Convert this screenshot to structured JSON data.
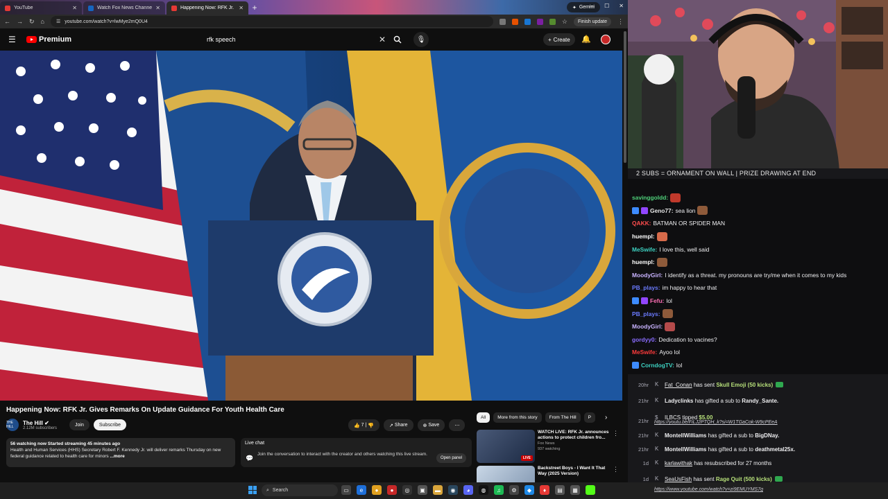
{
  "browser": {
    "tabs": [
      {
        "title": "YouTube",
        "active": false
      },
      {
        "title": "Watch Fox News Channel",
        "active": false
      },
      {
        "title": "Happening Now: RFK Jr. Gi",
        "active": true
      }
    ],
    "gemini_label": "Gemini",
    "url": "youtube.com/watch?v=lwMye2mQ0U4",
    "finish_update": "Finish update"
  },
  "youtube": {
    "logo_label": "Premium",
    "search_value": "rfk speech",
    "create_label": "Create",
    "video_title": "Happening Now: RFK Jr. Gives Remarks On Update Guidance For Youth Health Care",
    "channel": {
      "name": "The Hill",
      "subscribers": "2.12M subscribers",
      "avatar_text": "THE HILL"
    },
    "join_label": "Join",
    "subscribe_label": "Subscribe",
    "like_count": "7",
    "share_label": "Share",
    "save_label": "Save",
    "description": {
      "meta": "56 watching now  Started streaming 45 minutes ago",
      "text": "Health and Human Services (HHS) Secretary Robert F. Kennedy Jr. will deliver remarks Thursday on new federal guidance related to health care for minors",
      "more": "...more"
    },
    "live_chat": {
      "title": "Live chat",
      "text": "Join the conversation to interact with the creator and others watching this live stream.",
      "open_panel": "Open panel"
    },
    "chips": [
      "All",
      "More from this story",
      "From The Hill",
      "P"
    ],
    "recommendations": [
      {
        "title": "WATCH LIVE: RFK Jr. announces actions to protect children fro...",
        "channel": "Fox News",
        "stats": "937 watching",
        "badge": "LIVE"
      },
      {
        "title": "Backstreet Boys - I Want It That Way (2025 Version)",
        "channel": "",
        "stats": "",
        "badge": ""
      }
    ]
  },
  "taskbar": {
    "search_label": "Search"
  },
  "stream": {
    "banner": "2 SUBS = ORNAMENT ON WALL | PRIZE DRAWING AT END",
    "chat": [
      {
        "user": "savinggoldd:",
        "text": "",
        "color": "#4fd17a",
        "emote": true,
        "badges": 0
      },
      {
        "user": "Geno77:",
        "text": "sea lion",
        "color": "#e8e8e8",
        "emote": true,
        "badges": 2
      },
      {
        "user": "QAKK:",
        "text": "BATMAN OR SPIDER MAN",
        "color": "#ff4d4d",
        "emote": false,
        "badges": 0
      },
      {
        "user": "huempl:",
        "text": "",
        "color": "#ffffff",
        "emote": true,
        "badges": 0
      },
      {
        "user": "MeSwife:",
        "text": "I love this, well said",
        "color": "#3dd1c1",
        "emote": false,
        "badges": 0
      },
      {
        "user": "huempl:",
        "text": "",
        "color": "#ffffff",
        "emote": true,
        "badges": 0
      },
      {
        "user": "MoodyGirl:",
        "text": "I identify as a threat. my pronouns are try/me when it comes to my kids",
        "color": "#c9b3ff",
        "emote": false,
        "badges": 0
      },
      {
        "user": "PB_plays:",
        "text": "im happy to hear that",
        "color": "#6b7bff",
        "emote": false,
        "badges": 0
      },
      {
        "user": "Fefu:",
        "text": "lol",
        "color": "#ff6fb5",
        "emote": false,
        "badges": 2
      },
      {
        "user": "PB_plays:",
        "text": "",
        "color": "#6b7bff",
        "emote": true,
        "badges": 0
      },
      {
        "user": "MoodyGirl:",
        "text": "",
        "color": "#c9b3ff",
        "emote": true,
        "badges": 0
      },
      {
        "user": "gordyy0:",
        "text": "Dedication to vacines?",
        "color": "#8a6dff",
        "emote": false,
        "badges": 0
      },
      {
        "user": "MeSwife:",
        "text": "Ayoo lol",
        "color": "#ff3b3b",
        "emote": false,
        "badges": 0
      },
      {
        "user": "CorndogTV:",
        "text": "lol",
        "color": "#3dd1c1",
        "emote": false,
        "badges": 1
      }
    ],
    "events": [
      {
        "time": "20hr",
        "name": "Fat_Conan",
        "action": "has sent",
        "item": "Skull Emoji (50 kicks)",
        "type": "kick"
      },
      {
        "time": "21hr",
        "name": "Ladyclinks",
        "action": "has gifted a sub to",
        "item": "Randy_Sante.",
        "type": "gift"
      },
      {
        "time": "21hr",
        "name": "ILBCS",
        "action": "tipped",
        "item": "$5.00",
        "type": "tip",
        "link": "https://youtu.be/FiLJ2PTQH_k?si=W1TGaCok-W9cPEeA"
      },
      {
        "time": "21hr",
        "name": "MontellWilliams",
        "action": "has gifted a sub to",
        "item": "BigDNay.",
        "type": "gift"
      },
      {
        "time": "21hr",
        "name": "MontellWilliams",
        "action": "has gifted a sub to",
        "item": "deathmetal25x.",
        "type": "gift"
      },
      {
        "time": "1d",
        "name": "karlawithak",
        "action": "has resubscribed for 27 months",
        "item": "",
        "type": "resub"
      },
      {
        "time": "1d",
        "name": "SeaUsFish",
        "action": "has sent",
        "item": "Rage Quit (500 kicks)",
        "type": "kick",
        "link": "https://www.youtube.com/watch?v=zi9EMUYMS7g"
      }
    ]
  },
  "colors": {
    "youtube_red": "#ff0000",
    "twitch_bg": "#0e0e10",
    "kick_green": "#53fc18"
  }
}
